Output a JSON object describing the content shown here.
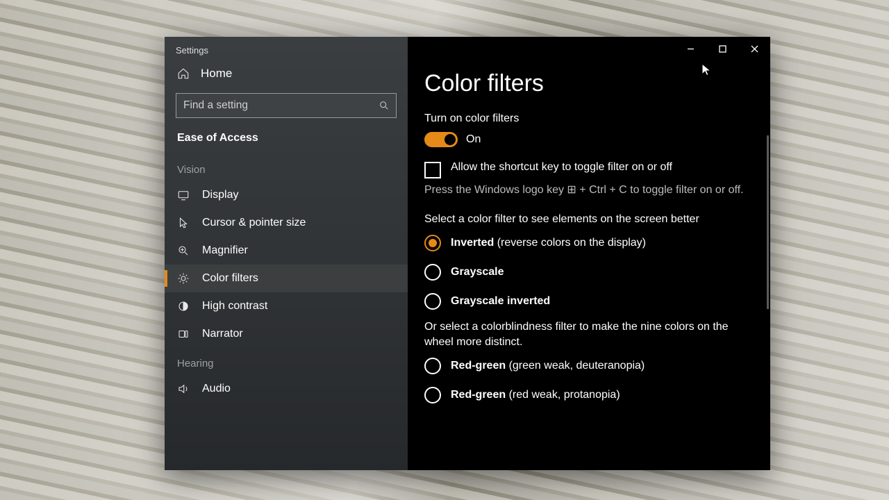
{
  "window_title": "Settings",
  "accent": "#e58a18",
  "sidebar": {
    "home": "Home",
    "search_placeholder": "Find a setting",
    "category": "Ease of Access",
    "group_vision": "Vision",
    "group_hearing": "Hearing",
    "items": [
      {
        "label": "Display"
      },
      {
        "label": "Cursor & pointer size"
      },
      {
        "label": "Magnifier"
      },
      {
        "label": "Color filters"
      },
      {
        "label": "High contrast"
      },
      {
        "label": "Narrator"
      }
    ],
    "hearing_items": [
      {
        "label": "Audio"
      }
    ]
  },
  "main": {
    "heading": "Color filters",
    "toggle_label": "Turn on color filters",
    "toggle_value": "On",
    "shortcut_checkbox": "Allow the shortcut key to toggle filter on or off",
    "shortcut_hint": "Press the Windows logo key ⊞ + Ctrl + C to toggle filter on or off.",
    "select_lead": "Select a color filter to see elements on the screen better",
    "cb_lead": "Or select a colorblindness filter to make the nine colors on the wheel more distinct.",
    "options": [
      {
        "bold": "Inverted",
        "rest": " (reverse colors on the display)",
        "selected": true
      },
      {
        "bold": "Grayscale",
        "rest": ""
      },
      {
        "bold": "Grayscale inverted",
        "rest": ""
      }
    ],
    "cb_options": [
      {
        "bold": "Red-green",
        "rest": " (green weak, deuteranopia)"
      },
      {
        "bold": "Red-green",
        "rest": " (red weak, protanopia)"
      }
    ]
  }
}
